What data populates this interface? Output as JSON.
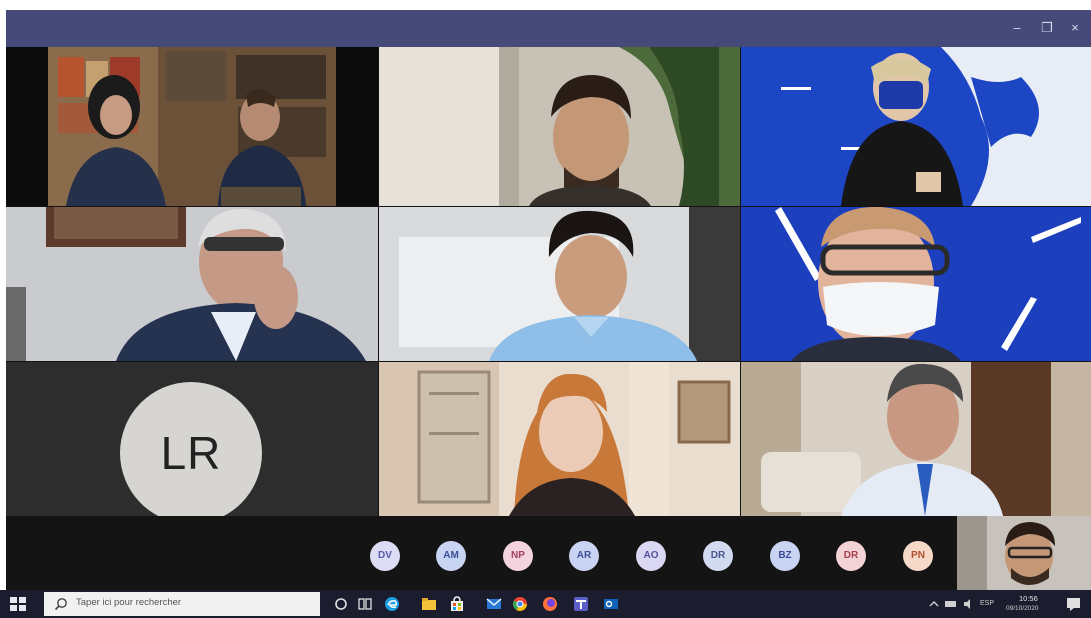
{
  "window": {
    "controls": {
      "minimize": "–",
      "maximize": "❐",
      "close": "×"
    }
  },
  "tiles": [
    {
      "name": "video-tile-1",
      "kind": "video"
    },
    {
      "name": "video-tile-2",
      "kind": "video"
    },
    {
      "name": "video-tile-3",
      "kind": "video"
    },
    {
      "name": "video-tile-4",
      "kind": "video"
    },
    {
      "name": "video-tile-5",
      "kind": "video"
    },
    {
      "name": "video-tile-6",
      "kind": "video"
    },
    {
      "name": "avatar-tile-lr",
      "kind": "avatar",
      "initials": "LR"
    },
    {
      "name": "video-tile-8",
      "kind": "video"
    },
    {
      "name": "video-tile-9",
      "kind": "video"
    }
  ],
  "participant_strip": [
    {
      "initials": "DV",
      "bg": "#dcdcf4",
      "fg": "#5a5aa6"
    },
    {
      "initials": "AM",
      "bg": "#c9d4f3",
      "fg": "#3b4f97"
    },
    {
      "initials": "NP",
      "bg": "#f3d3de",
      "fg": "#a3405f"
    },
    {
      "initials": "AR",
      "bg": "#c9d4f3",
      "fg": "#3b4f97"
    },
    {
      "initials": "AO",
      "bg": "#d9d7f2",
      "fg": "#5a4fa0"
    },
    {
      "initials": "DR",
      "bg": "#d2daf0",
      "fg": "#48588f"
    },
    {
      "initials": "BZ",
      "bg": "#c9d4f3",
      "fg": "#3b4f97"
    },
    {
      "initials": "DR",
      "bg": "#f3d3d6",
      "fg": "#a3404a"
    },
    {
      "initials": "PN",
      "bg": "#f6d8c8",
      "fg": "#b0502a"
    }
  ],
  "taskbar": {
    "search_placeholder": "Taper ici pour rechercher",
    "lang": "ESP",
    "time": "10:56",
    "date": "09/10/2020"
  },
  "colors": {
    "titlebar": "#454a78",
    "taskbar": "#1b1d2e",
    "accent_blue": "#1d4fd8"
  }
}
